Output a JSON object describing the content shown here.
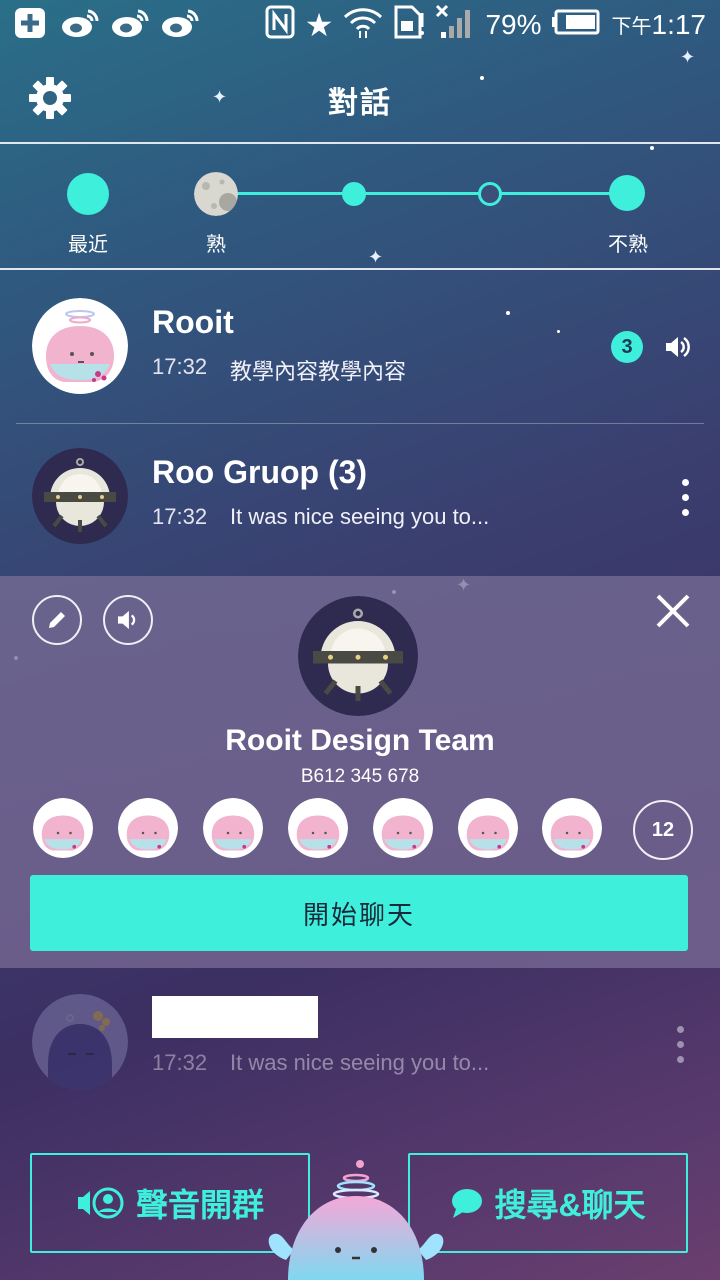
{
  "status_bar": {
    "battery_percent": "79%",
    "clock_prefix": "下午",
    "clock_time": "1:17"
  },
  "header": {
    "title": "對話",
    "settings_icon": "gear-icon"
  },
  "filter": {
    "labels": [
      "最近",
      "熟",
      "不熟"
    ],
    "accent_color": "#3ef0dc"
  },
  "chats": [
    {
      "name": "Rooit",
      "time": "17:32",
      "preview": "教學內容教學內容",
      "unread": "3"
    },
    {
      "name": "Roo Gruop (3)",
      "time": "17:32",
      "preview": "It was nice seeing you to..."
    },
    {
      "name": "",
      "time": "17:32",
      "preview": "It was nice seeing you to..."
    }
  ],
  "group_panel": {
    "name": "Rooit Design Team",
    "id": "B612 345 678",
    "member_count": "12",
    "start_chat_label": "開始聊天"
  },
  "bottom": {
    "voice_label": "聲音開群",
    "search_label": "搜尋&聊天"
  }
}
